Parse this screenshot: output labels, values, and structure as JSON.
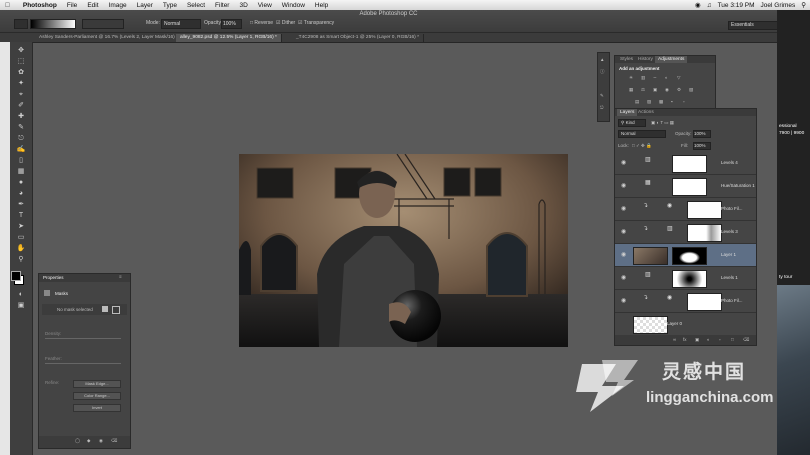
{
  "menubar": {
    "app": "Photoshop",
    "items": [
      "File",
      "Edit",
      "Image",
      "Layer",
      "Type",
      "Select",
      "Filter",
      "3D",
      "View",
      "Window",
      "Help"
    ],
    "clock": "Tue 3:19 PM",
    "user": "Joel Grimes"
  },
  "window": {
    "title": "Adobe Photoshop CC"
  },
  "options": {
    "mode_label": "Mode:",
    "mode_value": "Normal",
    "opacity_label": "Opacity:",
    "opacity_value": "100%",
    "reverse": "Reverse",
    "dither": "Dither",
    "transparency": "Transparency",
    "workspace": "Essentials"
  },
  "tabs": [
    "Ashley Sanders-Parliament @ 16.7% (Levels 2, Layer Mask/16) *",
    "alley_9082.psd @ 12.5% (Layer 1, RGB/16) *",
    "_T4C2908 as Smart Object-1 @ 25% (Layer 0, RGB/16) *"
  ],
  "properties": {
    "title": "Properties",
    "masks_label": "Masks",
    "no_mask": "No mask selected",
    "density": "Density:",
    "feather": "Feather:",
    "refine": "Refine:",
    "mask_edge": "Mask Edge...",
    "color_range": "Color Range...",
    "invert": "Invert"
  },
  "adjustments": {
    "tabs": [
      "Styles",
      "History",
      "Adjustments"
    ],
    "heading": "Add an adjustment"
  },
  "layers_panel": {
    "tabs": [
      "Layers",
      "Actions"
    ],
    "kind": "Kind",
    "blend": "Normal",
    "opacity_label": "Opacity:",
    "opacity_value": "100%",
    "lock_label": "Lock:",
    "fill_label": "Fill:",
    "fill_value": "100%",
    "layers": [
      {
        "name": "Levels 4",
        "kind": "adjustment",
        "selected": false
      },
      {
        "name": "Hue/Saturation 1",
        "kind": "adjustment",
        "selected": false
      },
      {
        "name": "Photo Fil...",
        "kind": "adjustment-linked",
        "selected": false
      },
      {
        "name": "Levels 3",
        "kind": "adjustment-linked",
        "selected": false
      },
      {
        "name": "Layer 1",
        "kind": "pixel-mask",
        "selected": true
      },
      {
        "name": "Levels 1",
        "kind": "adjustment",
        "selected": false
      },
      {
        "name": "Photo Fil...",
        "kind": "adjustment-linked",
        "selected": false
      },
      {
        "name": "Layer 0",
        "kind": "pixel",
        "selected": false
      }
    ]
  },
  "desktop": {
    "text1": "essional",
    "text2": "7900 | 9900",
    "text3": "ty tour"
  },
  "watermark": {
    "main": "灵感中国",
    "url": "lingganchina.com"
  },
  "colors": {
    "selection": "#5e6f86",
    "panel": "#454545",
    "canvas": "#5a5a5a"
  }
}
